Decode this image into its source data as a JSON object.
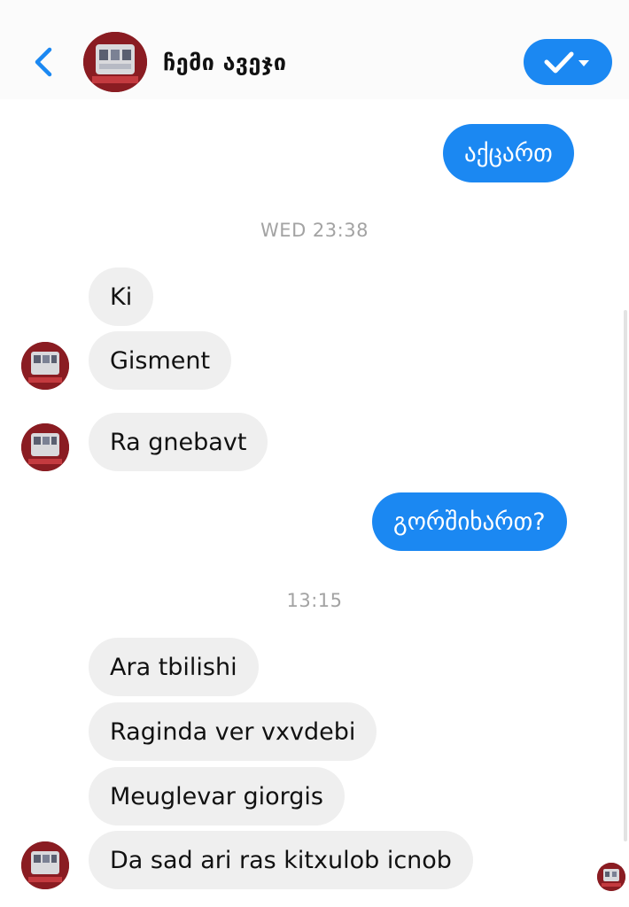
{
  "header": {
    "contact_name": "ჩემი ავეჯი",
    "back_icon": "chevron-left-icon",
    "action_icon": "check-dropdown-icon",
    "accent": "#1b88f2"
  },
  "conversation": {
    "msg_1": "აქცართ",
    "stamp_1": "WED 23:38",
    "msg_2": "Ki",
    "msg_3": "Gisment",
    "msg_4": "Ra gnebavt",
    "msg_5": "გორშიხართ?",
    "stamp_2": "13:15",
    "msg_6": "Ara tbilishi",
    "msg_7": "Raginda ver vxvdebi",
    "msg_8": "Meuglevar giorgis",
    "msg_9": "Da sad ari ras kitxulob icnob"
  },
  "colors": {
    "incoming_bubble": "#efefef",
    "outgoing_bubble": "#1b88f2",
    "timestamp": "#a3a3a3"
  }
}
